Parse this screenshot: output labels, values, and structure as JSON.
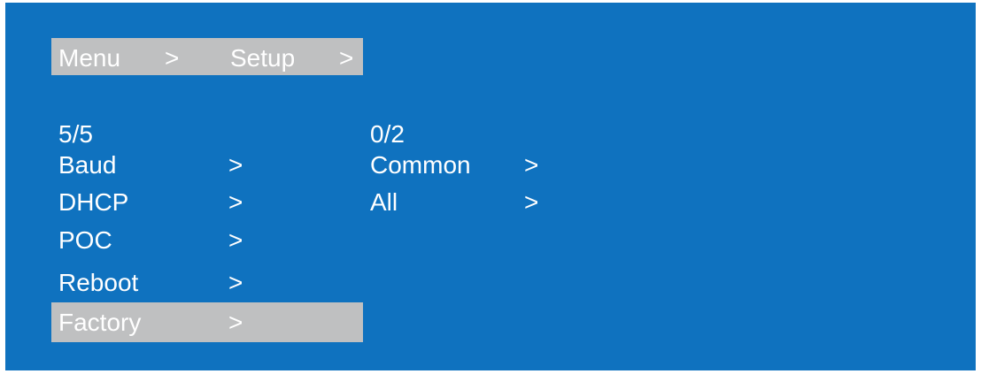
{
  "colors": {
    "screen_background": "#0f72bf",
    "highlight_background": "#bfc0c1",
    "text": "#ffffff"
  },
  "breadcrumb": {
    "items": [
      "Menu",
      "Setup"
    ],
    "separator": ">"
  },
  "left_menu": {
    "position": "5/5",
    "arrow": ">",
    "items": [
      {
        "label": "Baud"
      },
      {
        "label": "DHCP"
      },
      {
        "label": "POC"
      },
      {
        "label": "Reboot"
      },
      {
        "label": "Factory",
        "selected": true
      }
    ]
  },
  "right_menu": {
    "position": "0/2",
    "arrow": ">",
    "items": [
      {
        "label": "Common"
      },
      {
        "label": "All"
      }
    ]
  }
}
